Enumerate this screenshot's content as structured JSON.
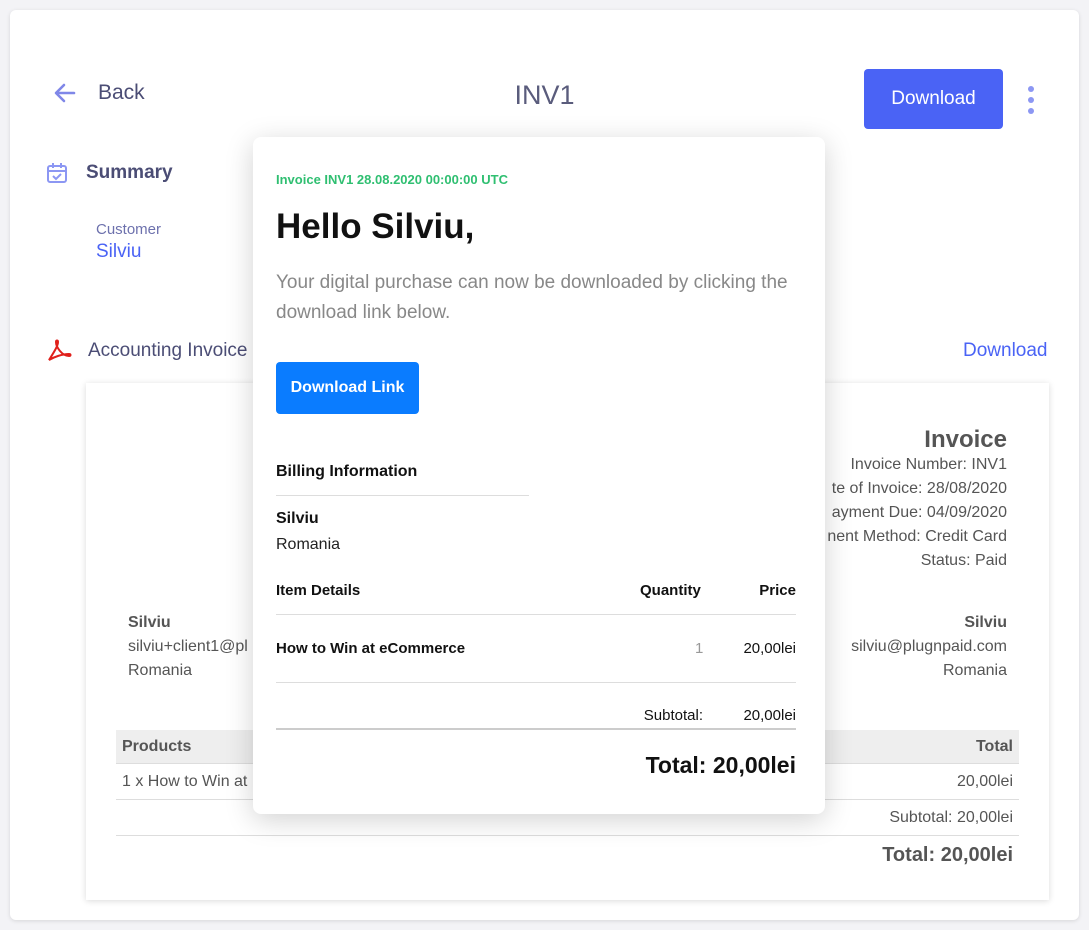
{
  "header": {
    "back_label": "Back",
    "title": "INV1",
    "download_label": "Download"
  },
  "summary": {
    "title": "Summary",
    "customer_label": "Customer",
    "customer_value": "Silviu"
  },
  "accounting": {
    "title": "Accounting Invoice",
    "download_label": "Download"
  },
  "invoice_doc": {
    "title": "Invoice",
    "meta": [
      "Invoice Number: INV1",
      "te of Invoice: 28/08/2020",
      "ayment Due: 04/09/2020",
      "nent Method: Credit Card",
      "Status: Paid"
    ],
    "from": {
      "name": "Silviu",
      "email": "silviu+client1@pl",
      "country": "Romania"
    },
    "to": {
      "name": "Silviu",
      "email": "silviu@plugnpaid.com",
      "country": "Romania"
    },
    "products_header": "Products",
    "total_header": "Total",
    "product_line": "1 x How to Win at",
    "product_total": "20,00lei",
    "subtotal": "Subtotal: 20,00lei",
    "total": "Total: 20,00lei"
  },
  "email": {
    "header": "Invoice INV1 28.08.2020 00:00:00 UTC",
    "greeting": "Hello Silviu,",
    "body": "Your digital purchase can now be downloaded by clicking the download link below.",
    "button_label": "Download Link",
    "billing_title": "Billing Information",
    "billing_name": "Silviu",
    "billing_country": "Romania",
    "items_header": {
      "item": "Item Details",
      "quantity": "Quantity",
      "price": "Price"
    },
    "item": {
      "name": "How to Win at eCommerce",
      "quantity": "1",
      "price": "20,00lei"
    },
    "subtotal_label": "Subtotal:",
    "subtotal_value": "20,00lei",
    "total": "Total:  20,00lei"
  }
}
